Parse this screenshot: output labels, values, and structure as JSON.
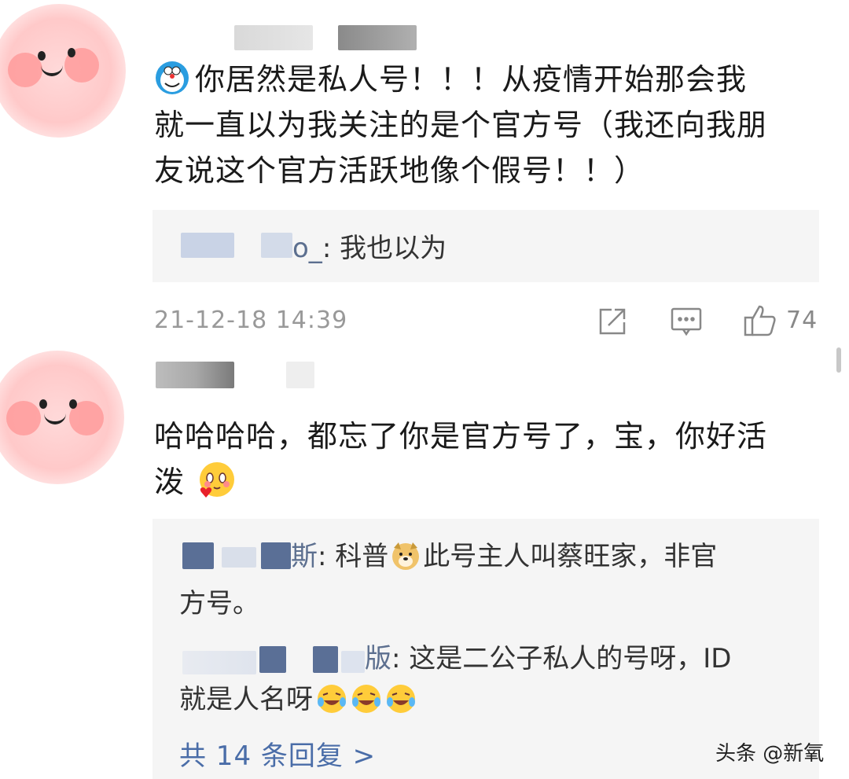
{
  "comment1": {
    "text_lines": [
      "你居然是私人号！！！从疫情开始那会我",
      "就一直以为我关注的是个官方号（我还向我朋",
      "友说这个官方活跃地像个假号！！）"
    ],
    "reply": {
      "name_suffix": "o_",
      "text": ": 我也以为"
    },
    "timestamp": "21-12-18 14:39",
    "likes": "74"
  },
  "comment2": {
    "text_lines": [
      "哈哈哈哈，都忘了你是官方号了，宝，你好活",
      "泼"
    ],
    "replies": [
      {
        "name_suffix": "斯",
        "text_before_emoji": ": 科普",
        "text_after_emoji": "此号主人叫蔡旺家，非官",
        "line2": "方号。"
      },
      {
        "name_suffix": "版",
        "text": ": 这是二公子私人的号呀，ID",
        "line2": "就是人名呀"
      }
    ],
    "more_replies": "共 14 条回复 >"
  },
  "watermark": "头条 @新氧",
  "icons": [
    "share-icon",
    "comment-icon",
    "thumbs-up-icon"
  ]
}
